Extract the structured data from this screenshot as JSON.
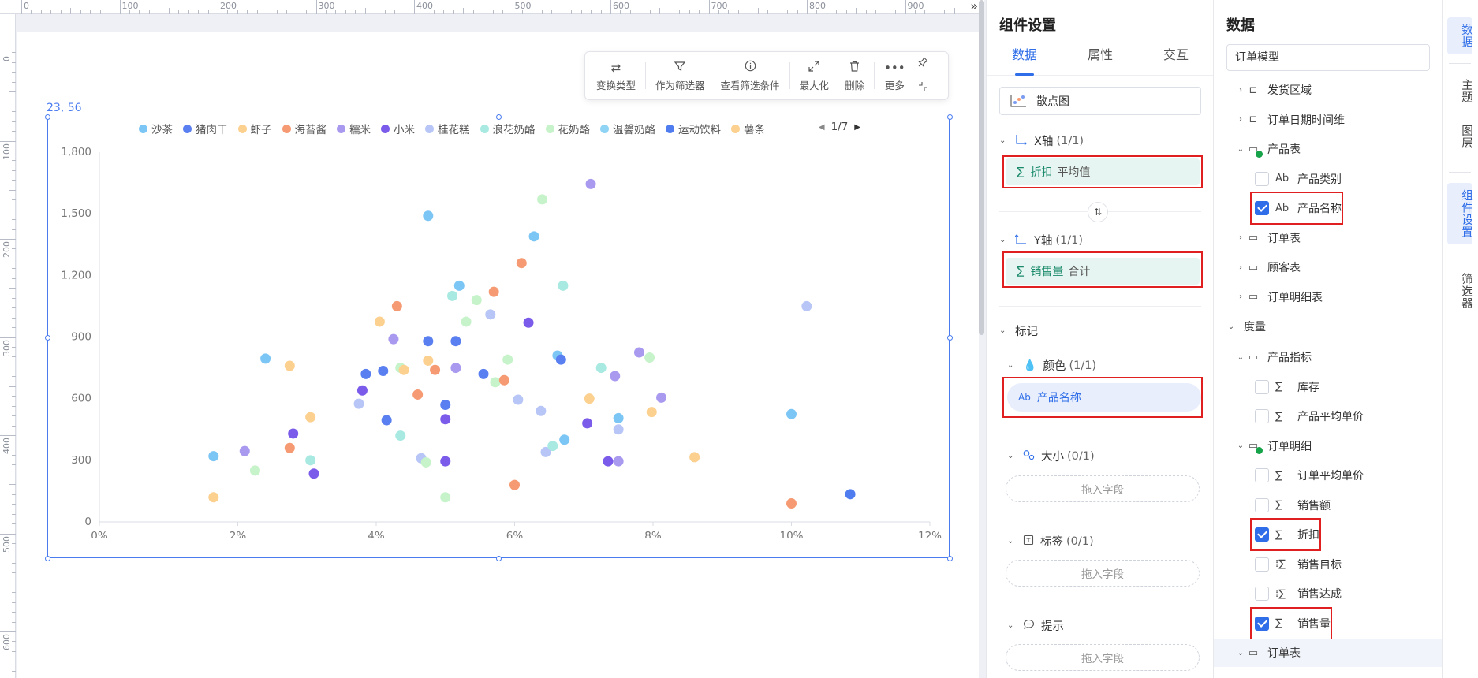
{
  "ruler": {
    "h_ticks": [
      "0",
      "100",
      "200",
      "300",
      "400",
      "500",
      "600",
      "700",
      "800",
      "900"
    ],
    "v_ticks": [
      "0",
      "100",
      "200",
      "300",
      "400",
      "500",
      "600"
    ],
    "collapse_glyph": "»"
  },
  "toolbar": {
    "change_type": "变换类型",
    "as_filter": "作为筛选器",
    "view_filter": "查看筛选条件",
    "maximize": "最大化",
    "delete": "删除",
    "more": "更多"
  },
  "coord_label": "23, 56",
  "legend": {
    "items": [
      {
        "name": "沙茶",
        "color": "#7cc6f5"
      },
      {
        "name": "猪肉干",
        "color": "#5a7ff0"
      },
      {
        "name": "虾子",
        "color": "#fcd08f"
      },
      {
        "name": "海苔酱",
        "color": "#f59a72"
      },
      {
        "name": "糯米",
        "color": "#a99af0"
      },
      {
        "name": "小米",
        "color": "#7b5cea"
      },
      {
        "name": "桂花糕",
        "color": "#b7c6f6"
      },
      {
        "name": "浪花奶酪",
        "color": "#a8eae2"
      },
      {
        "name": "花奶酪",
        "color": "#c6f3c9"
      },
      {
        "name": "温馨奶酪",
        "color": "#8fd3f5"
      },
      {
        "name": "运动饮料",
        "color": "#4f7df0"
      },
      {
        "name": "薯条",
        "color": "#fcd08f"
      }
    ],
    "pager": "1/7"
  },
  "chart_data": {
    "type": "scatter",
    "xlabel": "",
    "ylabel": "",
    "xlim": [
      0,
      12
    ],
    "ylim": [
      0,
      1800
    ],
    "x_ticks": [
      "0%",
      "2%",
      "4%",
      "6%",
      "8%",
      "10%",
      "12%"
    ],
    "y_ticks": [
      "0",
      "300",
      "600",
      "900",
      "1,200",
      "1,500",
      "1,800"
    ],
    "grid": false,
    "legend_position": "top",
    "points": [
      {
        "x": 1.65,
        "y": 320,
        "c": "#7cc6f5"
      },
      {
        "x": 1.65,
        "y": 120,
        "c": "#fcd08f"
      },
      {
        "x": 2.1,
        "y": 345,
        "c": "#a99af0"
      },
      {
        "x": 2.25,
        "y": 250,
        "c": "#c6f3c9"
      },
      {
        "x": 2.4,
        "y": 795,
        "c": "#7cc6f5"
      },
      {
        "x": 2.75,
        "y": 760,
        "c": "#fcd08f"
      },
      {
        "x": 2.75,
        "y": 360,
        "c": "#f59a72"
      },
      {
        "x": 2.8,
        "y": 430,
        "c": "#7b5cea"
      },
      {
        "x": 3.05,
        "y": 510,
        "c": "#fcd08f"
      },
      {
        "x": 3.05,
        "y": 300,
        "c": "#a8eae2"
      },
      {
        "x": 3.1,
        "y": 235,
        "c": "#7b5cea"
      },
      {
        "x": 3.75,
        "y": 575,
        "c": "#b7c6f6"
      },
      {
        "x": 3.8,
        "y": 640,
        "c": "#7b5cea"
      },
      {
        "x": 3.85,
        "y": 720,
        "c": "#5a7ff0"
      },
      {
        "x": 4.05,
        "y": 975,
        "c": "#fcd08f"
      },
      {
        "x": 4.1,
        "y": 735,
        "c": "#5a7ff0"
      },
      {
        "x": 4.15,
        "y": 495,
        "c": "#5a7ff0"
      },
      {
        "x": 4.25,
        "y": 890,
        "c": "#a99af0"
      },
      {
        "x": 4.3,
        "y": 1050,
        "c": "#f59a72"
      },
      {
        "x": 4.35,
        "y": 420,
        "c": "#a8eae2"
      },
      {
        "x": 4.35,
        "y": 750,
        "c": "#c6f3c9"
      },
      {
        "x": 4.4,
        "y": 740,
        "c": "#fcd08f"
      },
      {
        "x": 4.6,
        "y": 620,
        "c": "#f59a72"
      },
      {
        "x": 4.65,
        "y": 310,
        "c": "#b7c6f6"
      },
      {
        "x": 4.72,
        "y": 290,
        "c": "#c6f3c9"
      },
      {
        "x": 4.75,
        "y": 880,
        "c": "#5a7ff0"
      },
      {
        "x": 4.75,
        "y": 785,
        "c": "#fcd08f"
      },
      {
        "x": 4.75,
        "y": 1490,
        "c": "#7cc6f5"
      },
      {
        "x": 4.85,
        "y": 740,
        "c": "#f59a72"
      },
      {
        "x": 5.0,
        "y": 570,
        "c": "#5a7ff0"
      },
      {
        "x": 5.0,
        "y": 500,
        "c": "#7b5cea"
      },
      {
        "x": 5.0,
        "y": 295,
        "c": "#7b5cea"
      },
      {
        "x": 5.0,
        "y": 120,
        "c": "#c6f3c9"
      },
      {
        "x": 5.1,
        "y": 1100,
        "c": "#a8eae2"
      },
      {
        "x": 5.15,
        "y": 880,
        "c": "#5a7ff0"
      },
      {
        "x": 5.15,
        "y": 750,
        "c": "#a99af0"
      },
      {
        "x": 5.2,
        "y": 1150,
        "c": "#7cc6f5"
      },
      {
        "x": 5.3,
        "y": 975,
        "c": "#c6f3c9"
      },
      {
        "x": 5.45,
        "y": 1080,
        "c": "#c6f3c9"
      },
      {
        "x": 5.55,
        "y": 720,
        "c": "#5a7ff0"
      },
      {
        "x": 5.65,
        "y": 1010,
        "c": "#b7c6f6"
      },
      {
        "x": 5.7,
        "y": 1120,
        "c": "#f59a72"
      },
      {
        "x": 5.72,
        "y": 680,
        "c": "#c6f3c9"
      },
      {
        "x": 5.85,
        "y": 690,
        "c": "#f59a72"
      },
      {
        "x": 5.9,
        "y": 790,
        "c": "#c6f3c9"
      },
      {
        "x": 6.0,
        "y": 180,
        "c": "#f59a72"
      },
      {
        "x": 6.05,
        "y": 595,
        "c": "#b7c6f6"
      },
      {
        "x": 6.1,
        "y": 1260,
        "c": "#f59a72"
      },
      {
        "x": 6.2,
        "y": 970,
        "c": "#7b5cea"
      },
      {
        "x": 6.28,
        "y": 1390,
        "c": "#7cc6f5"
      },
      {
        "x": 6.38,
        "y": 540,
        "c": "#b7c6f6"
      },
      {
        "x": 6.4,
        "y": 1570,
        "c": "#c6f3c9"
      },
      {
        "x": 6.45,
        "y": 340,
        "c": "#b7c6f6"
      },
      {
        "x": 6.55,
        "y": 370,
        "c": "#a8eae2"
      },
      {
        "x": 6.62,
        "y": 810,
        "c": "#7cc6f5"
      },
      {
        "x": 6.67,
        "y": 790,
        "c": "#5a7ff0"
      },
      {
        "x": 6.7,
        "y": 1150,
        "c": "#a8eae2"
      },
      {
        "x": 6.72,
        "y": 400,
        "c": "#7cc6f5"
      },
      {
        "x": 7.05,
        "y": 480,
        "c": "#7b5cea"
      },
      {
        "x": 7.08,
        "y": 600,
        "c": "#fcd08f"
      },
      {
        "x": 7.1,
        "y": 1645,
        "c": "#a99af0"
      },
      {
        "x": 7.25,
        "y": 750,
        "c": "#a8eae2"
      },
      {
        "x": 7.35,
        "y": 295,
        "c": "#7b5cea"
      },
      {
        "x": 7.45,
        "y": 710,
        "c": "#a99af0"
      },
      {
        "x": 7.5,
        "y": 295,
        "c": "#a99af0"
      },
      {
        "x": 7.5,
        "y": 450,
        "c": "#b7c6f6"
      },
      {
        "x": 7.5,
        "y": 505,
        "c": "#7cc6f5"
      },
      {
        "x": 7.8,
        "y": 825,
        "c": "#a99af0"
      },
      {
        "x": 7.95,
        "y": 800,
        "c": "#c6f3c9"
      },
      {
        "x": 7.98,
        "y": 535,
        "c": "#fcd08f"
      },
      {
        "x": 8.12,
        "y": 605,
        "c": "#a99af0"
      },
      {
        "x": 8.6,
        "y": 315,
        "c": "#fcd08f"
      },
      {
        "x": 10.0,
        "y": 525,
        "c": "#7cc6f5"
      },
      {
        "x": 10.0,
        "y": 90,
        "c": "#f59a72"
      },
      {
        "x": 10.22,
        "y": 1050,
        "c": "#b7c6f6"
      },
      {
        "x": 10.85,
        "y": 135,
        "c": "#4f7df0"
      }
    ]
  },
  "settings": {
    "title": "组件设置",
    "tabs": [
      "数据",
      "属性",
      "交互"
    ],
    "chart_type": "散点图",
    "x_axis": {
      "label": "X轴",
      "count": "(1/1)",
      "field": "折扣",
      "agg": "平均值"
    },
    "y_axis": {
      "label": "Y轴",
      "count": "(1/1)",
      "field": "销售量",
      "agg": "合计"
    },
    "marks": {
      "label": "标记",
      "color": {
        "label": "颜色",
        "count": "(1/1)",
        "field": "产品名称"
      },
      "size": {
        "label": "大小",
        "count": "(0/1)",
        "drop": "拖入字段"
      },
      "tag": {
        "label": "标签",
        "count": "(0/1)",
        "drop": "拖入字段"
      },
      "tip": {
        "label": "提示",
        "drop": "拖入字段"
      }
    }
  },
  "data_panel": {
    "title": "数据",
    "model": "订单模型",
    "rows": [
      {
        "type": "folder",
        "label": "发货区域"
      },
      {
        "type": "folder",
        "label": "订单日期时间维"
      },
      {
        "type": "table_ok",
        "label": "产品表"
      },
      {
        "type": "field",
        "label": "产品类别",
        "checked": false
      },
      {
        "type": "field",
        "label": "产品名称",
        "checked": true
      },
      {
        "type": "folder2",
        "label": "订单表"
      },
      {
        "type": "folder2",
        "label": "顾客表"
      },
      {
        "type": "folder2",
        "label": "订单明细表"
      },
      {
        "type": "section",
        "label": "度量"
      },
      {
        "type": "open_folder",
        "label": "产品指标"
      },
      {
        "type": "measure",
        "label": "库存",
        "checked": false
      },
      {
        "type": "measure",
        "label": "产品平均单价",
        "checked": false
      },
      {
        "type": "table_ok",
        "label": "订单明细"
      },
      {
        "type": "measure",
        "label": "订单平均单价",
        "checked": false
      },
      {
        "type": "measure",
        "label": "销售额",
        "checked": false
      },
      {
        "type": "measure",
        "label": "折扣",
        "checked": true
      },
      {
        "type": "calc",
        "label": "销售目标",
        "checked": false
      },
      {
        "type": "calc",
        "label": "销售达成",
        "checked": false
      },
      {
        "type": "measure",
        "label": "销售量",
        "checked": true
      },
      {
        "type": "open_folder",
        "label": "订单表"
      }
    ]
  },
  "rail": [
    "数据",
    "主题",
    "图层",
    "组件设置",
    "筛选器"
  ]
}
